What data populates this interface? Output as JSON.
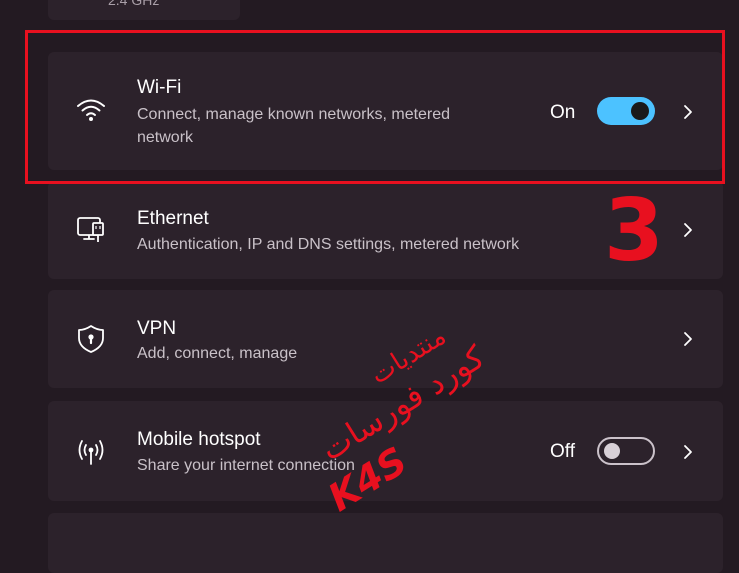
{
  "top_card": {
    "text": "2.4 GHz"
  },
  "items": {
    "wifi": {
      "title": "Wi-Fi",
      "desc_line1": "Connect, manage known networks, metered",
      "desc_line2": "network",
      "state": "On",
      "icon": "wifi-icon"
    },
    "ethernet": {
      "title": "Ethernet",
      "desc": "Authentication, IP and DNS settings, metered network",
      "icon": "ethernet-icon"
    },
    "vpn": {
      "title": "VPN",
      "desc": "Add, connect, manage",
      "icon": "shield-lock-icon"
    },
    "hotspot": {
      "title": "Mobile hotspot",
      "desc": "Share your internet connection",
      "state": "Off",
      "icon": "hotspot-icon"
    }
  },
  "annotation": {
    "step_number": "3",
    "watermark_line1": "منتديات",
    "watermark_line2": "كورد فورسات",
    "watermark_logo": "K4S",
    "highlight_color": "#e8101f"
  },
  "colors": {
    "background": "#231a22",
    "card": "#2c222b",
    "accent": "#4cc2ff"
  }
}
